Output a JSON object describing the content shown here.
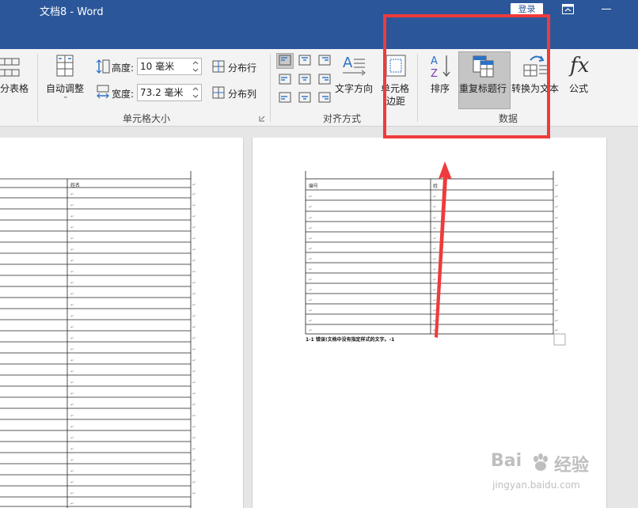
{
  "app": {
    "title": "文档8  -  Word",
    "login_label": "登录"
  },
  "ribbon": {
    "merge": {
      "split_table_label": "分表格"
    },
    "cell_size": {
      "autofit_label": "自动调整",
      "height_label": "高度:",
      "height_value": "10 毫米",
      "width_label": "宽度:",
      "width_value": "73.2 毫米",
      "distribute_rows_label": "分布行",
      "distribute_cols_label": "分布列",
      "group_label": "单元格大小"
    },
    "alignment": {
      "text_direction_label": "文字方向",
      "cell_margins_label_1": "单元格",
      "cell_margins_label_2": "边距",
      "group_label": "对齐方式"
    },
    "data": {
      "sort_label": "排序",
      "repeat_header_label": "重复标题行",
      "convert_to_text_label": "转换为文本",
      "formula_label": "公式",
      "group_label": "数据"
    }
  },
  "document": {
    "left_table_header": "姓名",
    "right_table_header_1": "编号",
    "right_table_header_2": "姓",
    "caption": "1-1 错误!文档中没有指定样式的文字。-1"
  },
  "watermark": {
    "brand": "Bai",
    "brand_suffix": "经验",
    "url": "jingyan.baidu.com"
  },
  "colors": {
    "title_bar": "#2b579a",
    "annotation_red": "#ef3b3b"
  },
  "icons": [
    "word-logo",
    "restore-ribbon-icon",
    "minimize-icon",
    "split-table-icon",
    "autofit-icon",
    "row-height-icon",
    "col-width-icon",
    "distribute-rows-icon",
    "distribute-cols-icon",
    "text-direction-icon",
    "cell-margins-icon",
    "sort-icon",
    "repeat-header-icon",
    "convert-to-text-icon",
    "formula-icon",
    "up-arrow-annotation"
  ]
}
